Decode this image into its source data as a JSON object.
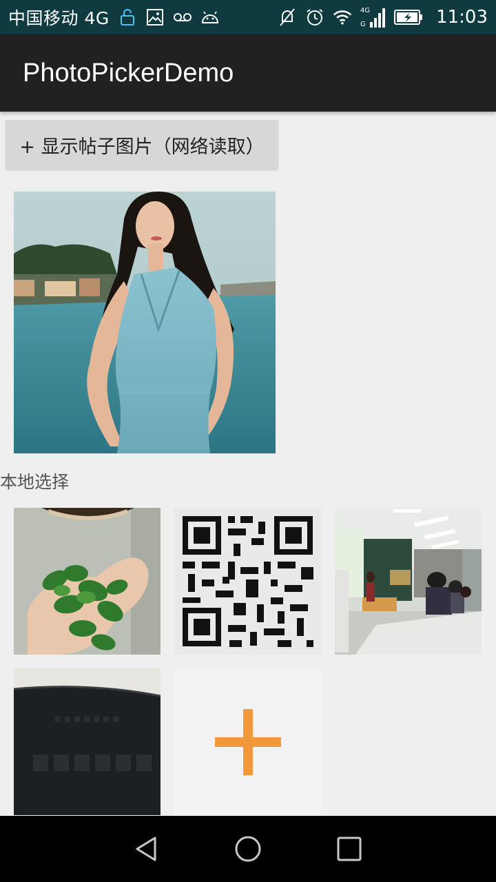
{
  "status_bar": {
    "carrier": "中国移动 4G",
    "time": "11:03",
    "icons": [
      "lock-icon",
      "image-icon",
      "voicemail-icon",
      "android-icon",
      "mute-icon",
      "alarm-icon",
      "wifi-icon",
      "signal-icon",
      "battery-icon"
    ],
    "network_label_top": "4G",
    "network_label_bottom": "G"
  },
  "app_bar": {
    "title": "PhotoPickerDemo"
  },
  "post_section": {
    "button_label": "+ 显示帖子图片（网络读取）"
  },
  "local_section": {
    "label": "本地选择",
    "add_icon": "plus-icon",
    "accent_color": "#f0983a"
  },
  "nav_bar": {
    "buttons": [
      "back-icon",
      "home-icon",
      "recents-icon"
    ]
  }
}
